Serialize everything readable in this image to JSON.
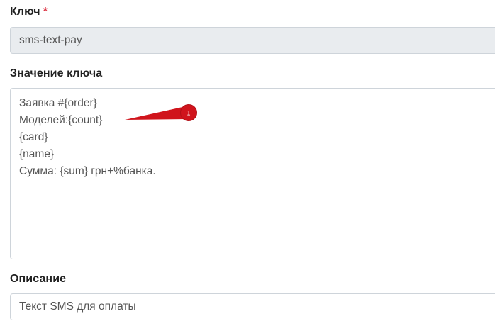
{
  "form": {
    "key_label": "Ключ",
    "key_required_mark": "*",
    "key_value": "sms-text-pay",
    "value_label": "Значение ключа",
    "value_lines": [
      "Заявка #{order}",
      "Моделей:{count}",
      "{card}",
      "{name}",
      "Сумма: {sum} грн+%банка."
    ],
    "description_label": "Описание",
    "description_value": "Текст SMS для оплаты"
  },
  "annotation": {
    "marker_number": "1",
    "marker_color": "#d0141c"
  }
}
